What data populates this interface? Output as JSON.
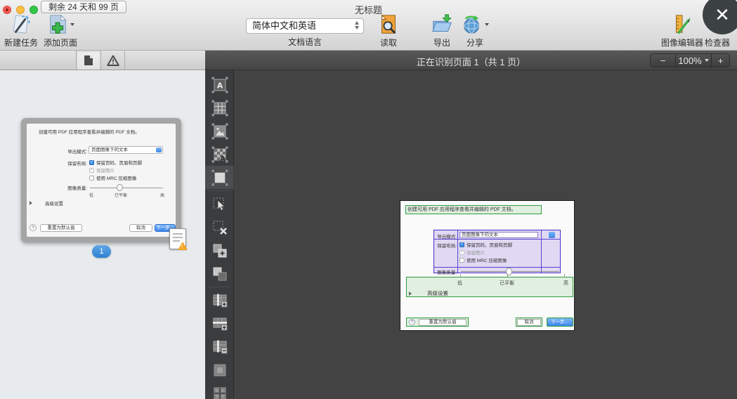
{
  "window": {
    "title": "无标题",
    "trial_badge": "剩余 24 天和 99 页",
    "close_glyph": "✕"
  },
  "toolbar": {
    "new_task": "新建任务",
    "add_pages": "添加页面",
    "language": {
      "value": "简体中文和英语",
      "label": "文档语言"
    },
    "read": "读取",
    "export": "导出",
    "share": "分享",
    "image_editor": "图像编辑器",
    "inspector": "检查器"
  },
  "statusbar": {
    "status_text": "正在识别页面 1（共 1 页）",
    "zoom": {
      "out": "−",
      "level": "100%",
      "in": "+"
    }
  },
  "sidebar": {
    "page_badge": "1"
  },
  "dialog": {
    "description": "创建可用 PDF 应用程序查看并编辑的 PDF 文档。",
    "export_mode": {
      "label": "导出模式:",
      "value": "页面图像下的文本"
    },
    "layout": {
      "label": "保留布局:",
      "options": [
        {
          "label": "保留页码、页眉和页脚",
          "checked": true,
          "enabled": true
        },
        {
          "label": "保留图片",
          "checked": true,
          "enabled": false
        },
        {
          "label": "使用 MRC 压缩图像",
          "checked": false,
          "enabled": true
        }
      ]
    },
    "quality": {
      "label": "图像质量:",
      "ticks": [
        "低",
        "已平衡",
        "高"
      ],
      "value": "已平衡"
    },
    "advanced": "高级设置",
    "help": "?",
    "reset": "重置为默认值",
    "cancel": "取消",
    "next": "下一步…",
    "checkmark": "✓"
  },
  "tools": [
    "text-area",
    "table-area",
    "picture-area",
    "background-picture-area",
    "recognition-area",
    "select-area",
    "delete-area",
    "add-area-part",
    "remove-area-part",
    "add-table-column",
    "add-table-row",
    "remove-table-lines",
    "merge-cells",
    "split-cells"
  ],
  "colors": {
    "text_zone": "#2f9e3f",
    "table_zone": "#4a2ec7",
    "accent_blue": "#2f7fd0",
    "canvas": "#434343"
  }
}
